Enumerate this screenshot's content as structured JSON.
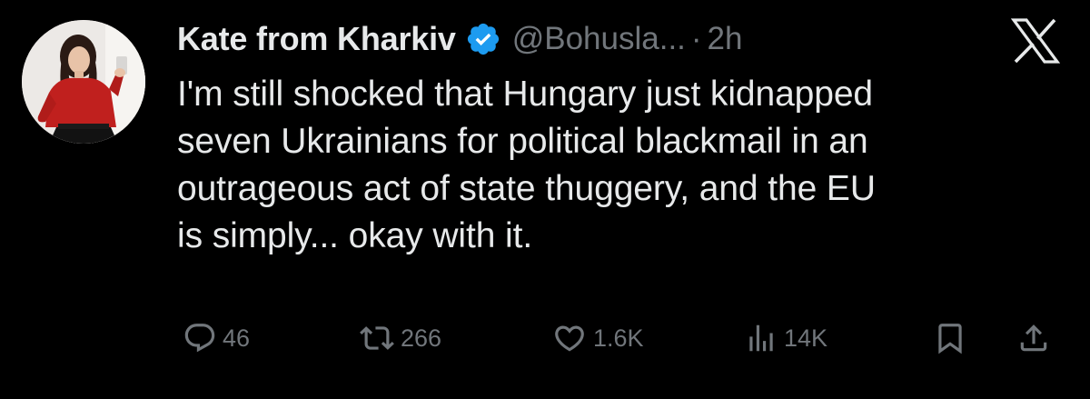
{
  "author": {
    "display_name": "Kate from Kharkiv",
    "handle": "@Bohusla...",
    "separator": "·",
    "time": "2h",
    "verified": true
  },
  "tweet": {
    "lines": [
      "I'm still shocked that Hungary just kidnapped",
      "seven Ukrainians for political blackmail in an",
      "outrageous act of state thuggery, and the EU",
      "is simply... okay with it."
    ]
  },
  "actions": {
    "replies": "46",
    "reposts": "266",
    "likes": "1.6K",
    "views": "14K"
  },
  "colors": {
    "background": "#000000",
    "text": "#e7e9ea",
    "secondary": "#71767b",
    "verified_badge": "#1d9bf0"
  },
  "icons": {
    "verified": "verified-badge-icon",
    "platform": "x-logo-icon",
    "reply": "reply-icon",
    "repost": "repost-icon",
    "like": "heart-icon",
    "views": "views-bar-chart-icon",
    "bookmark": "bookmark-icon",
    "share": "share-icon"
  }
}
